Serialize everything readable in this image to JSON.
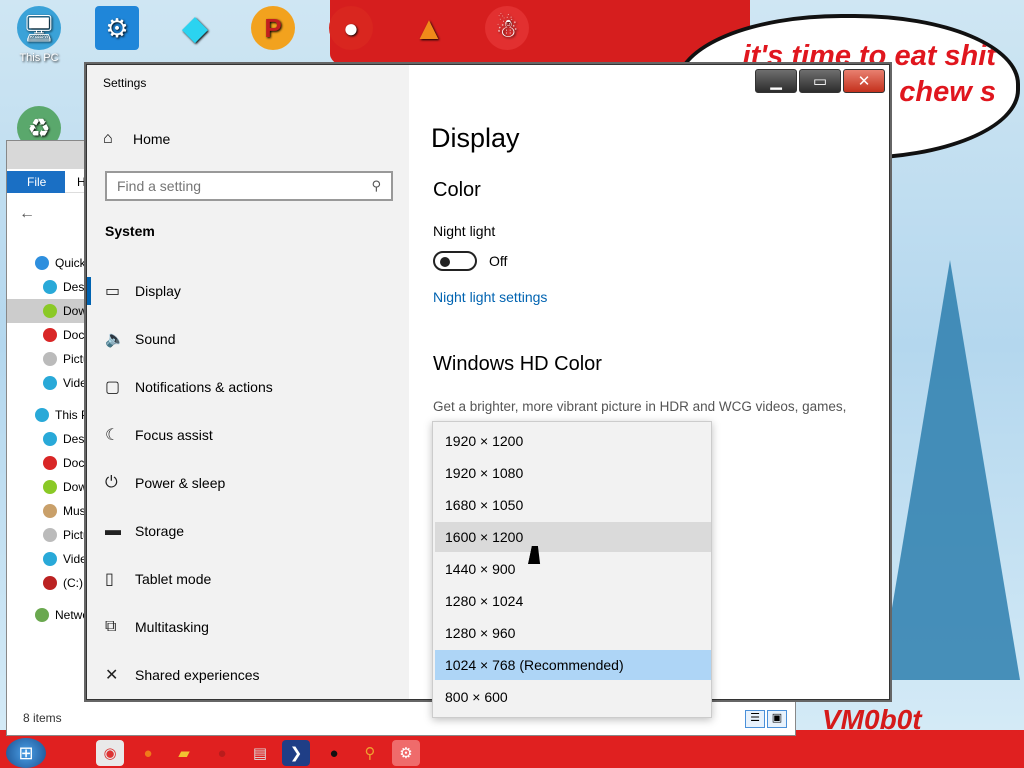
{
  "desktop": {
    "speech_text": "it's time to eat shit chew s",
    "signature_text": "VM0b0t",
    "icons": [
      {
        "label": "This PC",
        "icon": "monitor-icon"
      },
      {
        "label": "",
        "icon": "gear-icon"
      },
      {
        "label": "",
        "icon": "diamond-icon"
      },
      {
        "label": "",
        "icon": "p-logo-icon"
      },
      {
        "label": "",
        "icon": "angry-bird-icon"
      },
      {
        "label": "",
        "icon": "vlc-cone-icon"
      },
      {
        "label": "",
        "icon": "santa-icon"
      }
    ]
  },
  "explorer": {
    "file_tab": "File",
    "home_tab": "H",
    "tree": [
      "Quick",
      "Desk",
      "Dow",
      "Docu",
      "Pictu",
      "Vide",
      "This P",
      "Desk",
      "Docu",
      "Dow",
      "Mus",
      "Pictu",
      "Vide",
      "(C:)",
      "Netwo"
    ],
    "status": "8 items"
  },
  "settings": {
    "window_title": "Settings",
    "home_label": "Home",
    "search_placeholder": "Find a setting",
    "category": "System",
    "nav": [
      {
        "label": "Display",
        "icon": "monitor-icon",
        "active": true
      },
      {
        "label": "Sound",
        "icon": "speaker-icon"
      },
      {
        "label": "Notifications & actions",
        "icon": "notification-icon"
      },
      {
        "label": "Focus assist",
        "icon": "moon-icon"
      },
      {
        "label": "Power & sleep",
        "icon": "power-icon"
      },
      {
        "label": "Storage",
        "icon": "storage-icon"
      },
      {
        "label": "Tablet mode",
        "icon": "tablet-icon"
      },
      {
        "label": "Multitasking",
        "icon": "multitasking-icon"
      },
      {
        "label": "Shared experiences",
        "icon": "share-icon"
      }
    ],
    "main": {
      "page_title": "Display",
      "color_heading": "Color",
      "night_light_label": "Night light",
      "night_light_state": "Off",
      "night_light_link": "Night light settings",
      "hdr_heading": "Windows HD Color",
      "hdr_desc": "Get a brighter, more vibrant picture in HDR and WCG videos, games,"
    },
    "resolution_options": [
      "1920 × 1200",
      "1920 × 1080",
      "1680 × 1050",
      "1600 × 1200",
      "1440 × 900",
      "1280 × 1024",
      "1280 × 960",
      "1024 × 768 (Recommended)",
      "800 × 600"
    ],
    "hovered_option_index": 3,
    "selected_option_index": 7
  },
  "colors": {
    "accent": "#0063b1",
    "selected_option": "#aed5f6",
    "hover_option": "#dadada"
  }
}
